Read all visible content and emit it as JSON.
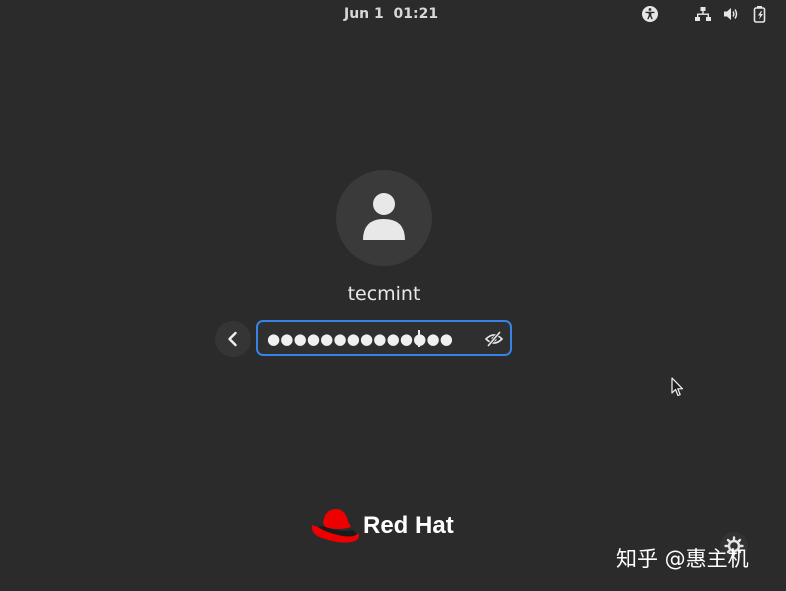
{
  "topbar": {
    "clock": "Jun 1  01:21",
    "icons": [
      "accessibility-icon",
      "network-wired-icon",
      "volume-icon",
      "battery-charging-icon"
    ]
  },
  "login": {
    "username": "tecmint",
    "password_mask": "●●●●●●●●●●●●●●",
    "password_char_count": 14
  },
  "branding": {
    "logo_text": "Red Hat",
    "logo_color": "#ee0000"
  },
  "watermark": {
    "text": "知乎 @惠主机"
  },
  "colors": {
    "background": "#2b2b2b",
    "focus_ring": "#3584e4"
  }
}
